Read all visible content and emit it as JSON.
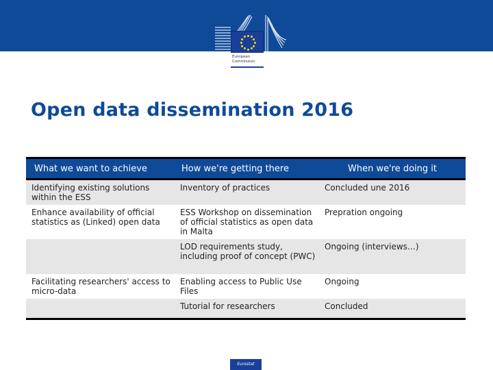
{
  "header": {
    "logo": {
      "icon": "eu-flag-icon",
      "line1": "European",
      "line2": "Commission"
    }
  },
  "title": "Open data dissemination 2016",
  "table": {
    "columns": [
      "What we want to achieve",
      "How we're getting there",
      "When we're doing it"
    ],
    "rows": [
      {
        "what": "Identifying existing solutions within the ESS",
        "how": "Inventory of practices",
        "when": "Concluded une 2016",
        "shaded": true
      },
      {
        "what": "Enhance availability of official statistics as (Linked) open data",
        "how": "ESS Workshop on dissemination of official statistics as open data in Malta",
        "when": "Prepration ongoing",
        "shaded": false
      },
      {
        "what": "",
        "how": "LOD requirements study, including proof of concept (PWC)",
        "when": "Ongoing (interviews…)",
        "shaded": true
      },
      {
        "what": "Facilitating researchers' access to micro-data",
        "how": "Enabling access to Public Use Files",
        "when": "Ongoing",
        "shaded": false
      },
      {
        "what": "",
        "how": "Tutorial for researchers",
        "when": "Concluded",
        "shaded": true
      }
    ]
  },
  "footer": {
    "badge": "Eurostat"
  },
  "colors": {
    "brand_blue": "#0f4a98",
    "row_shade": "#e6e6e6"
  }
}
